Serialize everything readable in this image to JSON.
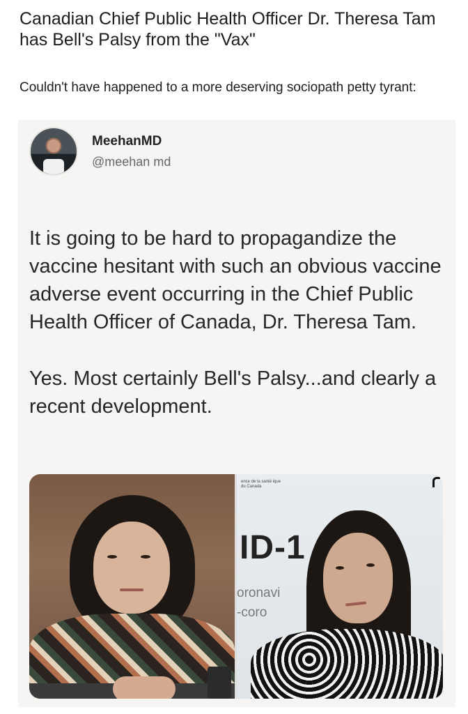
{
  "post": {
    "title": "Canadian Chief Public Health Officer Dr. Theresa Tam has Bell's Palsy from the \"Vax\"",
    "body": "Couldn't have happened to a more deserving sociopath petty tyrant:"
  },
  "tweet": {
    "display_name": "MeehanMD",
    "handle": "@meehan md",
    "paragraph_1": "It is going to be hard to propagandize the vaccine hesitant with such an obvious vaccine adverse event occurring in the Chief Public Health Officer of Canada, Dr. Theresa Tam.",
    "paragraph_2": "Yes. Most certainly Bell's Palsy...and clearly a recent development."
  },
  "photos": {
    "right_sign": {
      "small_text": "ence de la santé ique du Canada",
      "big_text": "ID-1",
      "line_1": "oronavi",
      "line_2": "-coro"
    }
  },
  "colors": {
    "card_background": "#f6f5f3",
    "text": "#1c1c1c",
    "handle": "#666666"
  }
}
